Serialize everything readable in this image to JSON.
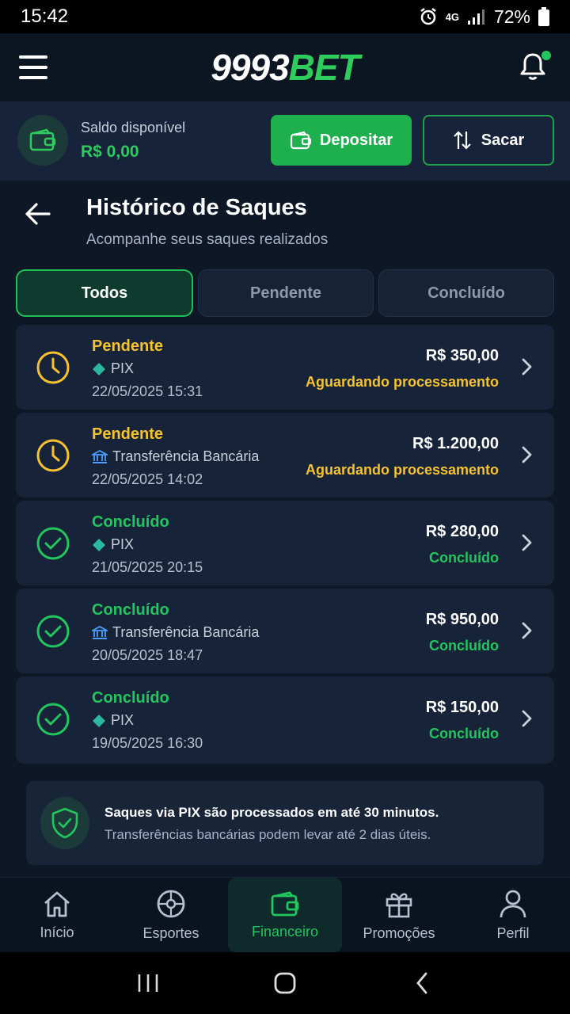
{
  "status_bar": {
    "time": "15:42",
    "network": "4G",
    "battery": "72%"
  },
  "header": {
    "logo_number": "9993",
    "logo_brand": "BET"
  },
  "balance": {
    "label": "Saldo disponível",
    "value": "R$ 0,00",
    "deposit_label": "Depositar",
    "withdraw_label": "Sacar"
  },
  "page": {
    "title": "Histórico de Saques",
    "subtitle": "Acompanhe seus saques realizados"
  },
  "tabs": [
    {
      "label": "Todos",
      "active": true
    },
    {
      "label": "Pendente",
      "active": false
    },
    {
      "label": "Concluído",
      "active": false
    }
  ],
  "withdrawals": [
    {
      "status": "Pendente",
      "method": "PIX",
      "method_icon": "pix-icon",
      "date": "22/05/2025 15:31",
      "amount": "R$ 350,00",
      "note": "Aguardando processamento"
    },
    {
      "status": "Pendente",
      "method": "Transferência Bancária",
      "method_icon": "bank-icon",
      "date": "22/05/2025 14:02",
      "amount": "R$ 1.200,00",
      "note": "Aguardando processamento"
    },
    {
      "status": "Concluído",
      "method": "PIX",
      "method_icon": "pix-icon",
      "date": "21/05/2025 20:15",
      "amount": "R$ 280,00",
      "note": "Concluído"
    },
    {
      "status": "Concluído",
      "method": "Transferência Bancária",
      "method_icon": "bank-icon",
      "date": "20/05/2025 18:47",
      "amount": "R$ 950,00",
      "note": "Concluído"
    },
    {
      "status": "Concluído",
      "method": "PIX",
      "method_icon": "pix-icon",
      "date": "19/05/2025 16:30",
      "amount": "R$ 150,00",
      "note": "Concluído"
    }
  ],
  "info": {
    "line1": "Saques via PIX são processados em até 30 minutos.",
    "line2": "Transferências bancárias podem levar até 2 dias úteis."
  },
  "bottom_nav": [
    {
      "label": "Início",
      "icon": "home-icon",
      "active": false
    },
    {
      "label": "Esportes",
      "icon": "sports-ball-icon",
      "active": false
    },
    {
      "label": "Financeiro",
      "icon": "wallet-icon",
      "active": true
    },
    {
      "label": "Promoções",
      "icon": "gift-icon",
      "active": false
    },
    {
      "label": "Perfil",
      "icon": "user-icon",
      "active": false
    }
  ],
  "colors": {
    "accent": "#22c55e",
    "pending": "#f5c231",
    "background": "#0e1726",
    "card": "#172338"
  }
}
